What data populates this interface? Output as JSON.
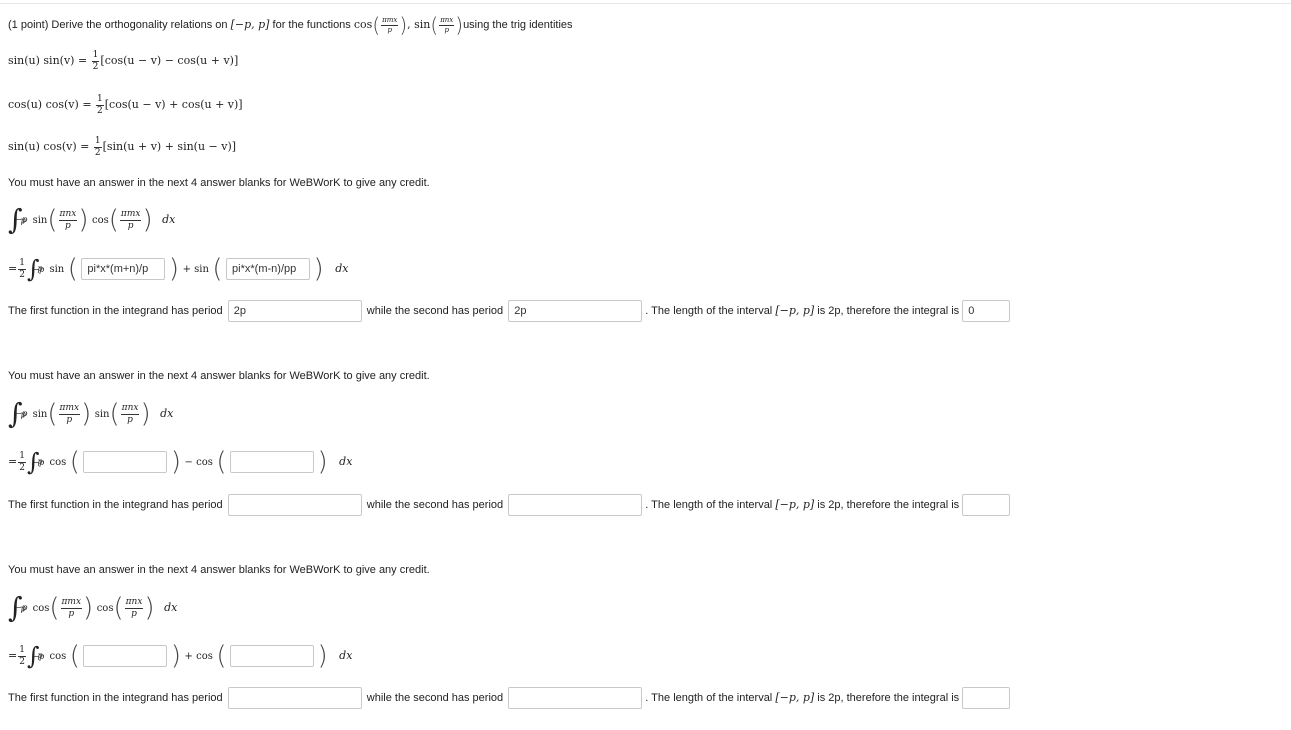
{
  "header": {
    "prefix": "(1 point) Derive the orthogonality relations on",
    "interval": "[−p, p]",
    "for_functions": "for the functions",
    "cos": "cos",
    "sin": "sin",
    "frac1_num": "πmx",
    "frac1_den": "p",
    "frac2_num": "πnx",
    "frac2_den": "p",
    "suffix": "using the trig identities"
  },
  "identities": [
    {
      "lhs": "sin(u) sin(v) =",
      "rhs": "[cos(u − v) − cos(u + v)]"
    },
    {
      "lhs": "cos(u) cos(v) =",
      "rhs": "[cos(u − v) + cos(u + v)]"
    },
    {
      "lhs": "sin(u) cos(v) =",
      "rhs": "[sin(u + v) + sin(u − v)]"
    }
  ],
  "half": {
    "num": "1",
    "den": "2"
  },
  "notice": "You must have an answer in the next 4 answer blanks for WeBWorK to give any credit.",
  "integral": {
    "upper": "p",
    "lower": "−p",
    "dx": "dx",
    "eq": "=",
    "frac_den": "p",
    "mx": "πmx",
    "nx": "πnx"
  },
  "parts": [
    {
      "f1": "sin",
      "f1_arg": "πnx",
      "f2": "cos",
      "f2_arg": "πmx",
      "g1": "sin",
      "op": "+ sin",
      "ans1": "pi*x*(m+n)/p",
      "ans2": "pi*x*(m-n)/pp",
      "period1": "2p",
      "period2": "2p",
      "integral_value": "0"
    },
    {
      "f1": "sin",
      "f1_arg": "πmx",
      "f2": "sin",
      "f2_arg": "πnx",
      "g1": "cos",
      "op": "− cos",
      "ans1": "",
      "ans2": "",
      "period1": "",
      "period2": "",
      "integral_value": ""
    },
    {
      "f1": "cos",
      "f1_arg": "πmx",
      "f2": "cos",
      "f2_arg": "πnx",
      "g1": "cos",
      "op": "+ cos",
      "ans1": "",
      "ans2": "",
      "period1": "",
      "period2": "",
      "integral_value": ""
    }
  ],
  "period_labels": {
    "first": "The first function in the integrand has period",
    "second": "while the second has period",
    "length_pre": ". The length of the interval",
    "length_interval": "[−p, p]",
    "length_post": "is 2p, therefore the integral is"
  }
}
